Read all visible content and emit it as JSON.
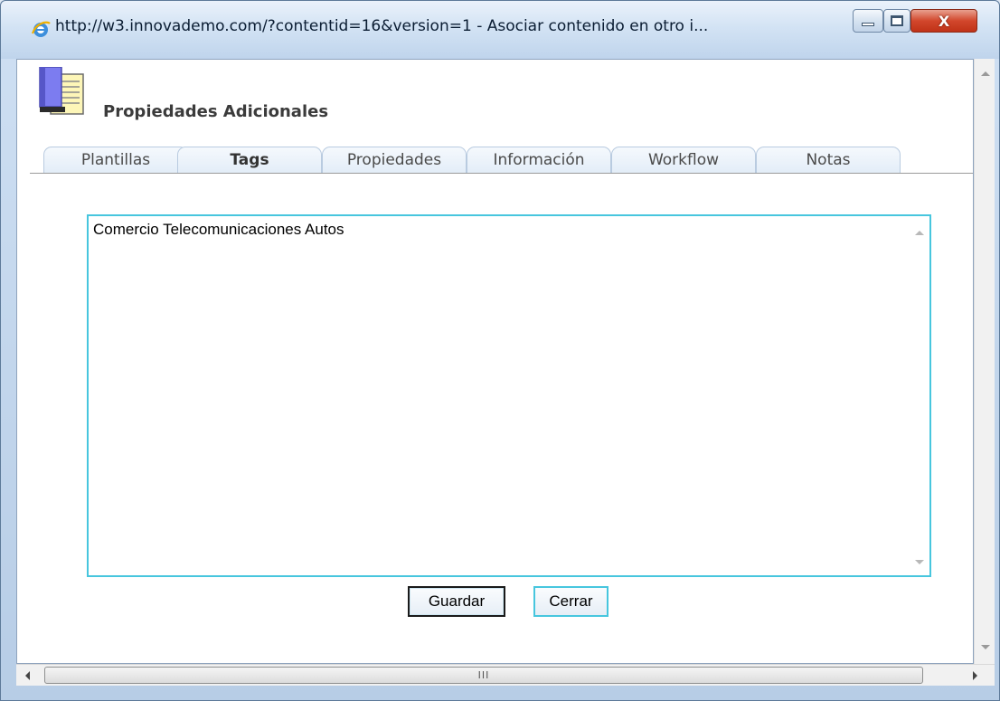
{
  "window": {
    "title": "http://w3.innovademo.com/?contentid=16&version=1 - Asociar contenido en otro i...",
    "icon": "ie-icon",
    "controls": {
      "minimize_icon": "minimize-icon",
      "maximize_icon": "maximize-icon",
      "close_label": "X"
    }
  },
  "header": {
    "title": "Propiedades Adicionales",
    "icon": "documents-icon"
  },
  "tabs": [
    {
      "label": "Plantillas",
      "active": false
    },
    {
      "label": "Tags",
      "active": true
    },
    {
      "label": "Propiedades",
      "active": false
    },
    {
      "label": "Información",
      "active": false
    },
    {
      "label": "Workflow",
      "active": false
    },
    {
      "label": "Notas",
      "active": false
    }
  ],
  "tags_field": {
    "value": "Comercio Telecomunicaciones Autos"
  },
  "buttons": {
    "save_label": "Guardar",
    "close_label": "Cerrar"
  },
  "scrollbar": {
    "grip": "III"
  },
  "colors": {
    "accent": "#47c6de",
    "close_button": "#d2472c"
  }
}
